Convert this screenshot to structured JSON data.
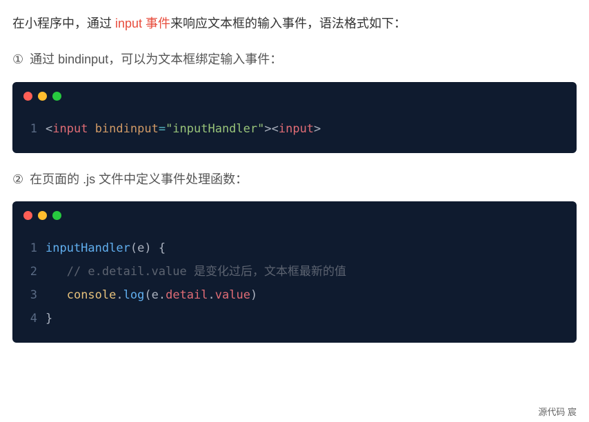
{
  "intro": {
    "pre": "在小程序中，通过 ",
    "highlight": "input 事件",
    "post": "来响应文本框的输入事件，语法格式如下："
  },
  "step1": {
    "num": "①",
    "text": "  通过 bindinput，可以为文本框绑定输入事件："
  },
  "step2": {
    "num": "②",
    "text": "  在页面的 .js 文件中定义事件处理函数："
  },
  "code1": {
    "lines": [
      {
        "num": "1",
        "tokens": [
          {
            "cls": "punct",
            "t": "<"
          },
          {
            "cls": "tag",
            "t": "input"
          },
          {
            "cls": "",
            "t": " "
          },
          {
            "cls": "attr",
            "t": "bindinput"
          },
          {
            "cls": "op",
            "t": "="
          },
          {
            "cls": "str",
            "t": "\"inputHandler\""
          },
          {
            "cls": "punct",
            "t": ">"
          },
          {
            "cls": "punct",
            "t": "<"
          },
          {
            "cls": "tag",
            "t": "input"
          },
          {
            "cls": "punct",
            "t": ">"
          }
        ]
      }
    ]
  },
  "code2": {
    "lines": [
      {
        "num": "1",
        "tokens": [
          {
            "cls": "func",
            "t": "inputHandler"
          },
          {
            "cls": "punct",
            "t": "("
          },
          {
            "cls": "param",
            "t": "e"
          },
          {
            "cls": "punct",
            "t": ")"
          },
          {
            "cls": "",
            "t": " "
          },
          {
            "cls": "brace",
            "t": "{"
          }
        ]
      },
      {
        "num": "2",
        "tokens": [
          {
            "cls": "",
            "t": "   "
          },
          {
            "cls": "comment",
            "t": "// e.detail.value 是变化过后，文本框最新的值"
          }
        ]
      },
      {
        "num": "3",
        "tokens": [
          {
            "cls": "",
            "t": "   "
          },
          {
            "cls": "method1",
            "t": "console"
          },
          {
            "cls": "punct",
            "t": "."
          },
          {
            "cls": "method2",
            "t": "log"
          },
          {
            "cls": "punct",
            "t": "("
          },
          {
            "cls": "param",
            "t": "e"
          },
          {
            "cls": "punct",
            "t": "."
          },
          {
            "cls": "prop",
            "t": "detail"
          },
          {
            "cls": "punct",
            "t": "."
          },
          {
            "cls": "prop",
            "t": "value"
          },
          {
            "cls": "punct",
            "t": ")"
          }
        ]
      },
      {
        "num": "4",
        "tokens": [
          {
            "cls": "brace",
            "t": "}"
          }
        ]
      }
    ]
  },
  "footer": "源代码   宸"
}
